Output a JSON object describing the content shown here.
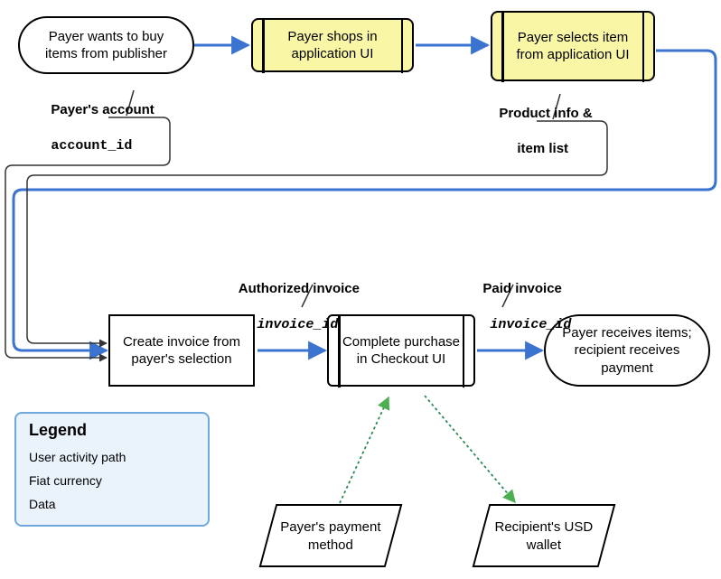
{
  "nodes": {
    "start": "Payer wants to buy items from publisher",
    "shops": "Payer shops in application UI",
    "selects": "Payer selects item from application UI",
    "create_invoice": "Create invoice from payer's selection",
    "checkout": "Complete purchase in Checkout UI",
    "receives": "Payer receives items; recipient receives payment",
    "payment_method": "Payer's payment method",
    "usd_wallet": "Recipient's USD wallet"
  },
  "labels": {
    "payer_account_1": "Payer's account",
    "payer_account_2": "account_id",
    "product_info_1": "Product info &",
    "product_info_2": "item list",
    "authorized_1": "Authorized invoice",
    "authorized_2": "invoice_id",
    "paid_1": "Paid invoice",
    "paid_2": "invoice_id"
  },
  "legend": {
    "title": "Legend",
    "user_activity": "User activity path",
    "fiat": "Fiat currency",
    "data": "Data"
  },
  "colors": {
    "user_path": "#3b73d1",
    "fiat": "#2e8b57",
    "data": "#333333",
    "yellow_fill": "#f9f7a6",
    "legend_border": "#6fa8dc",
    "legend_fill": "#eaf3fb"
  }
}
